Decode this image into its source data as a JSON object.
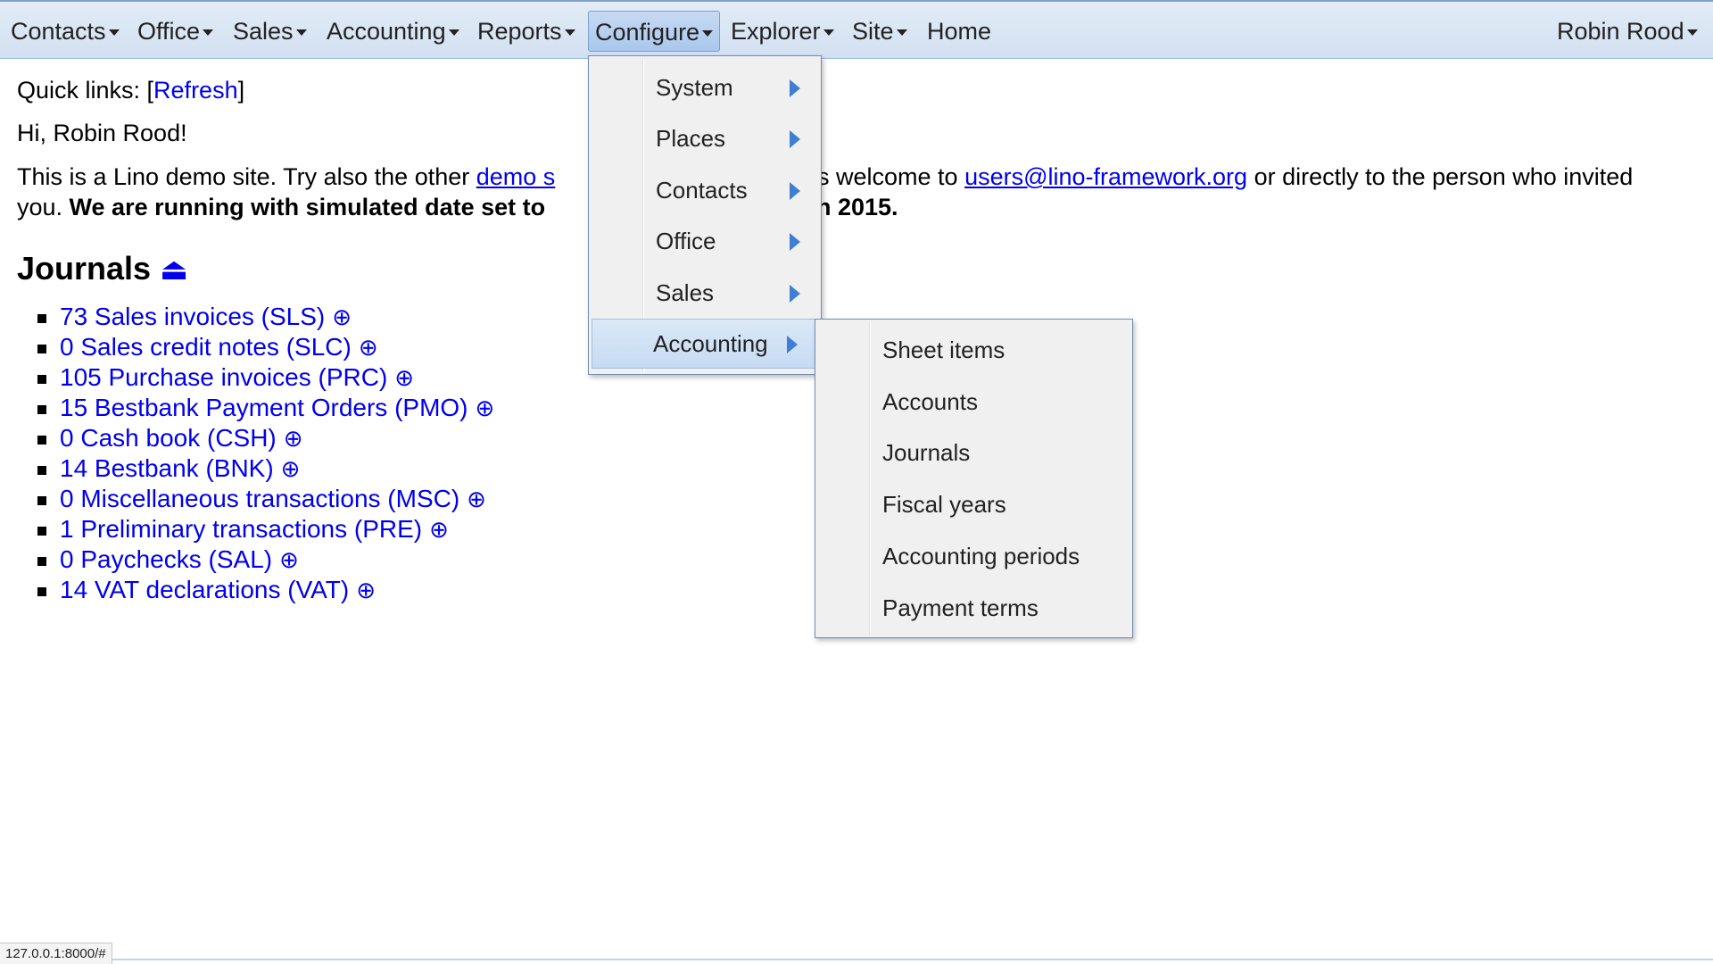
{
  "menubar": {
    "items": [
      {
        "label": "Contacts"
      },
      {
        "label": "Office"
      },
      {
        "label": "Sales"
      },
      {
        "label": "Accounting"
      },
      {
        "label": "Reports"
      },
      {
        "label": "Configure"
      },
      {
        "label": "Explorer"
      },
      {
        "label": "Site"
      },
      {
        "label": "Home"
      }
    ],
    "user": "Robin Rood",
    "active_item": "Configure"
  },
  "main": {
    "quick_links_prefix": "Quick links: [",
    "quick_links_refresh": "Refresh",
    "quick_links_suffix": "]",
    "greeting": "Hi, Robin Rood!",
    "intro_part1": "This is a Lino demo site. Try also the other ",
    "intro_link1": "demo s",
    "intro_part2": "s welcome to ",
    "intro_email": "users@lino-framework.org",
    "intro_part3": " or directly to the person who invited",
    "intro_line2_part1": "you. ",
    "intro_line2_bold1": "We are running with simulated date set to",
    "intro_line2_bold2": "n 2015.",
    "journals_title": "Journals",
    "journals_icon": "⏏",
    "journals": [
      {
        "label": "73 Sales invoices (SLS)"
      },
      {
        "label": "0 Sales credit notes (SLC)"
      },
      {
        "label": "105 Purchase invoices (PRC)"
      },
      {
        "label": "15 Bestbank Payment Orders (PMO)"
      },
      {
        "label": "0 Cash book (CSH)"
      },
      {
        "label": "14 Bestbank (BNK)"
      },
      {
        "label": "0 Miscellaneous transactions (MSC)"
      },
      {
        "label": "1 Preliminary transactions (PRE)"
      },
      {
        "label": "0 Paychecks (SAL)"
      },
      {
        "label": "14 VAT declarations (VAT)"
      }
    ],
    "plus_icon": "⊕"
  },
  "configure_menu": {
    "items": [
      {
        "label": "System"
      },
      {
        "label": "Places"
      },
      {
        "label": "Contacts"
      },
      {
        "label": "Office"
      },
      {
        "label": "Sales"
      },
      {
        "label": "Accounting"
      }
    ],
    "active_item": "Accounting"
  },
  "accounting_submenu": {
    "items": [
      {
        "label": "Sheet items"
      },
      {
        "label": "Accounts"
      },
      {
        "label": "Journals"
      },
      {
        "label": "Fiscal years"
      },
      {
        "label": "Accounting periods"
      },
      {
        "label": "Payment terms"
      }
    ]
  },
  "statusbar": {
    "url": "127.0.0.1:8000/#"
  },
  "colors": {
    "link": "#0000ee",
    "menubar_bg": "#d8e4f3",
    "active_menu_bg": "#b6d0ef",
    "submenu_arrow": "#3f7fd3"
  }
}
